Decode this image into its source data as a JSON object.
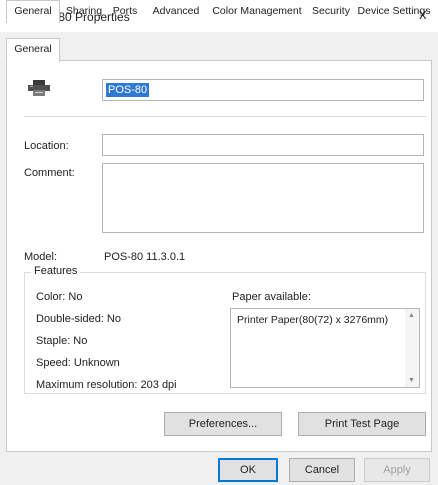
{
  "window": {
    "title": "POS-80 Properties",
    "close_glyph": "x"
  },
  "tabs": [
    {
      "label": "General",
      "active": true
    },
    {
      "label": "Sharing"
    },
    {
      "label": "Ports"
    },
    {
      "label": "Advanced"
    },
    {
      "label": "Color Management"
    },
    {
      "label": "Security"
    },
    {
      "label": "Device Settings"
    }
  ],
  "general": {
    "printer_icon": "printer-icon",
    "printer_name": "POS-80",
    "location_label": "Location:",
    "location_value": "",
    "comment_label": "Comment:",
    "comment_value": "",
    "model_label": "Model:",
    "model_value": "POS-80 11.3.0.1"
  },
  "features": {
    "title": "Features",
    "color": "Color: No",
    "double_sided": "Double-sided: No",
    "staple": "Staple: No",
    "speed": "Speed: Unknown",
    "max_resolution": "Maximum resolution: 203 dpi",
    "paper_label": "Paper available:",
    "paper_items": [
      "Printer Paper(80(72) x 3276mm)"
    ]
  },
  "buttons": {
    "preferences": "Preferences...",
    "print_test_page": "Print Test Page",
    "ok": "OK",
    "cancel": "Cancel",
    "apply": "Apply"
  },
  "colors": {
    "selection": "#3078d6",
    "default_button_border": "#0078d7"
  }
}
